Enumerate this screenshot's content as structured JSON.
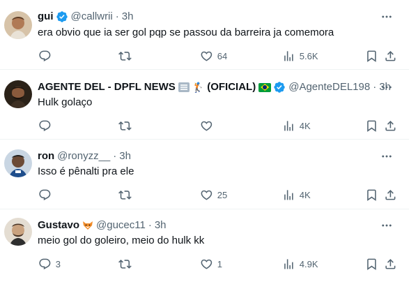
{
  "tweets": [
    {
      "name": "gui",
      "handle": "@callwrii",
      "dot": "·",
      "time": "3h",
      "text": "era obvio que ia ser gol pqp se passou da barreira ja comemora",
      "replies": "",
      "retweets": "",
      "likes": "64",
      "views": "5.6K",
      "verified": true
    },
    {
      "name": "AGENTE DEL - DPFL NEWS",
      "name_suffix": "(OFICIAL)",
      "handle": "@AgenteDEL198",
      "dot": "·",
      "time": "3h",
      "text": "Hulk golaço",
      "replies": "",
      "retweets": "",
      "likes": "",
      "views": "4K",
      "verified": true
    },
    {
      "name": "ron",
      "handle": "@ronyzz__",
      "dot": "·",
      "time": "3h",
      "text": "Isso é pênalti pra ele",
      "replies": "",
      "retweets": "",
      "likes": "25",
      "views": "4K",
      "verified": false
    },
    {
      "name": "Gustavo",
      "handle": "@gucec11",
      "dot": "·",
      "time": "3h",
      "text": "meio gol do goleiro, meio do hulk kk",
      "replies": "3",
      "retweets": "",
      "likes": "1",
      "views": "4.9K",
      "verified": false
    }
  ],
  "icons": {
    "reply": "reply-icon",
    "retweet": "retweet-icon",
    "like": "heart-icon",
    "views": "views-icon",
    "bookmark": "bookmark-icon",
    "share": "share-icon",
    "more": "more-icon",
    "verified": "verified-badge-icon"
  },
  "colors": {
    "verified": "#1d9bf0",
    "secondary_text": "#536471",
    "primary_text": "#0f1419",
    "divider": "#eff3f4"
  }
}
